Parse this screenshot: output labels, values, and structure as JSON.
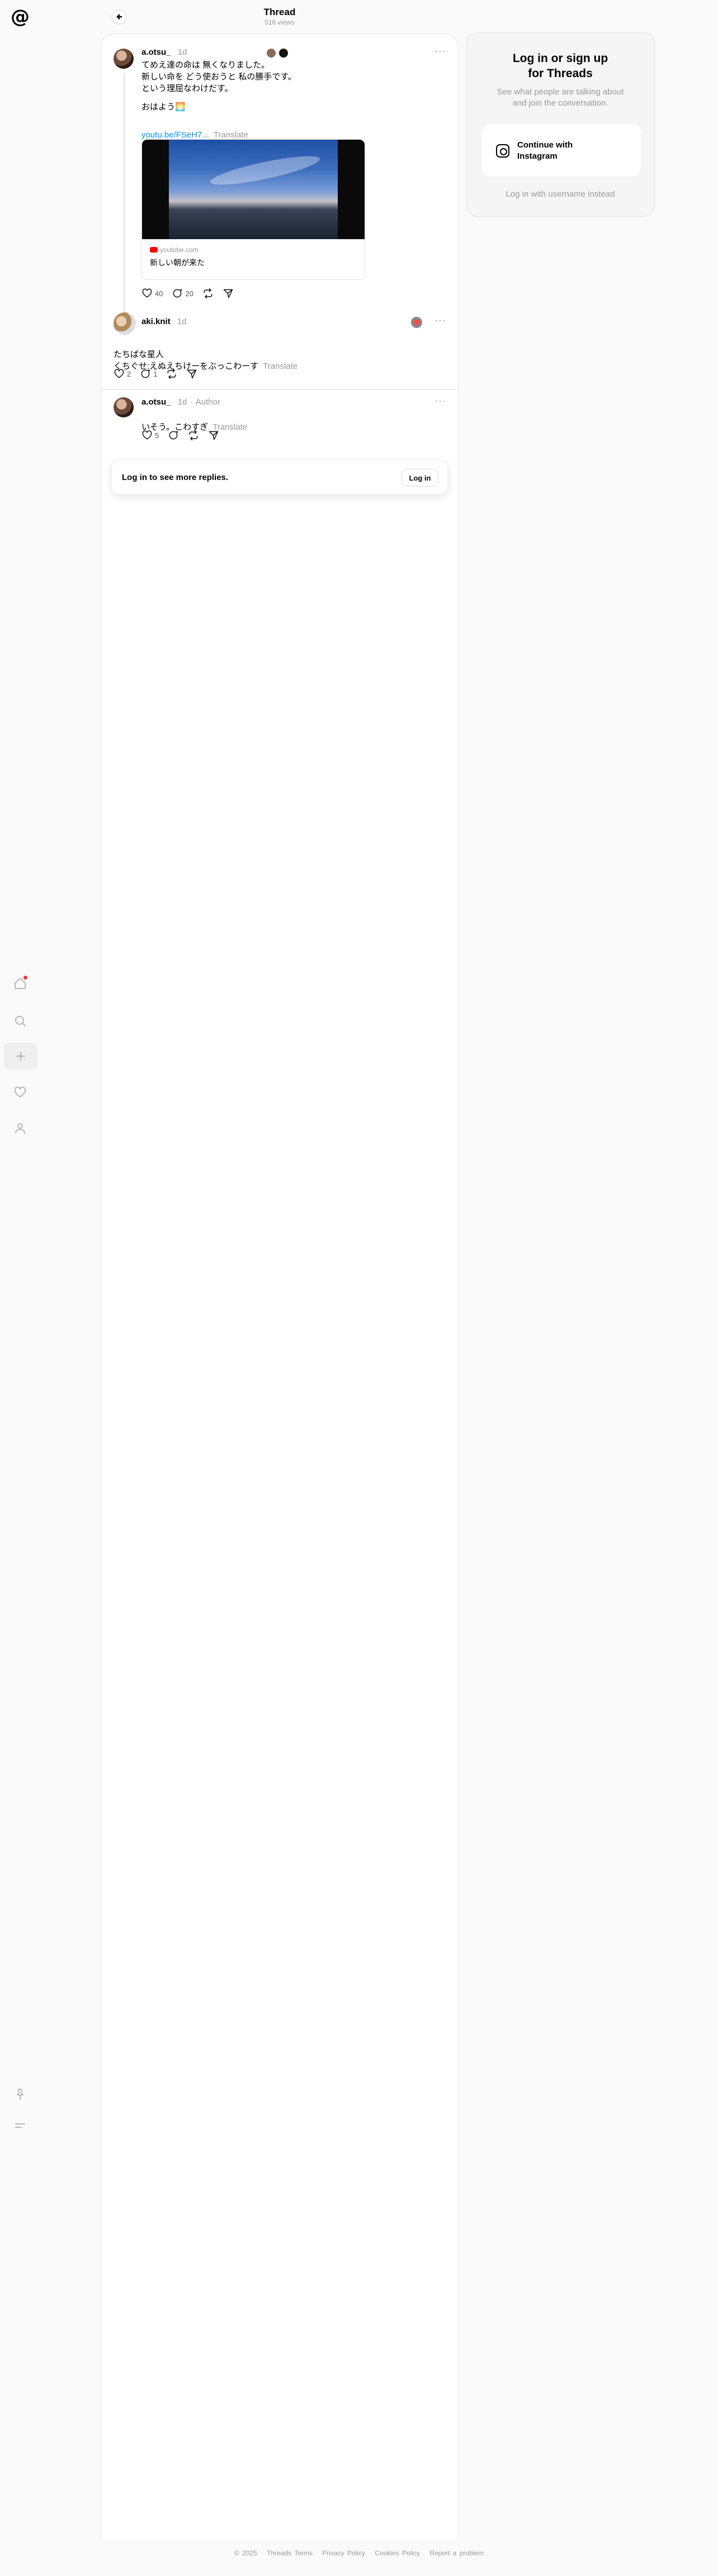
{
  "app": {
    "logo": "@"
  },
  "header": {
    "title": "Thread",
    "views": "516 views"
  },
  "main_post": {
    "username": "a.otsu_",
    "time": "1d",
    "text": "てめえ達の命は 無くなりました。\n新しい命を どう使おうと 私の勝手です。\nという理屈なわけだす。",
    "text2": "おはよう🌅",
    "link": "youtu.be/FSeH7...",
    "translate": "Translate",
    "card": {
      "domain": "youtube.com",
      "title": "新しい朝が来た"
    },
    "likes": "40",
    "replies": "20"
  },
  "reply1": {
    "username": "aki.knit",
    "time": "1d",
    "text": "たちばな星人\nくちぐせ:えぬえちけーをぶっこわーす",
    "translate": "Translate",
    "likes": "2",
    "replies": "1"
  },
  "reply2": {
    "username": "a.otsu_",
    "time": "1d",
    "author": "Author",
    "text": "いそう。こわすぎ",
    "translate": "Translate",
    "likes": "5"
  },
  "login_bar": {
    "text": "Log in to see more replies.",
    "button": "Log in"
  },
  "side_panel": {
    "title": "Log in or sign up\nfor Threads",
    "subtitle": "See what people are talking about\nand join the conversation.",
    "instagram_button": "Continue with\nInstagram",
    "alt_login": "Log in with username instead"
  },
  "footer": [
    "© 2025",
    "Threads Terms",
    "Privacy Policy",
    "Cookies Policy",
    "Report a problem"
  ],
  "colors": {
    "link": "#0095f6",
    "notification": "#ff3040"
  }
}
